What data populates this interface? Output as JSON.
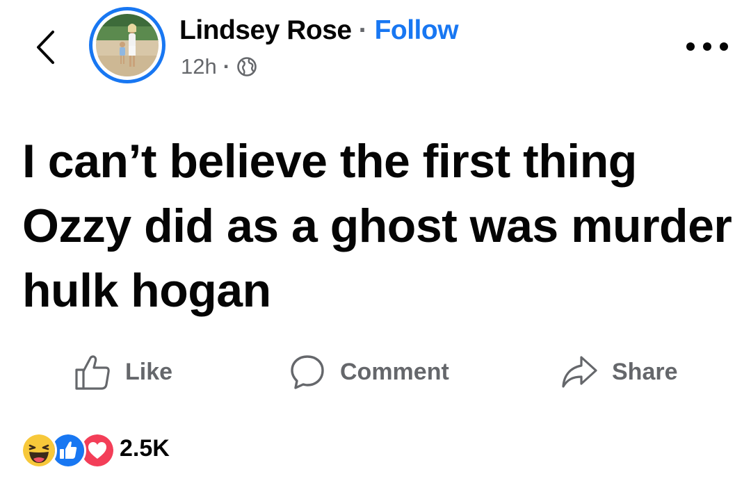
{
  "post": {
    "author": "Lindsey Rose",
    "separator": "·",
    "follow_label": "Follow",
    "timestamp": "12h",
    "meta_separator": "·",
    "audience_icon": "globe-icon",
    "text": "I can’t believe the first thing Ozzy did as a ghost was murder hulk hogan"
  },
  "actions": {
    "like_label": "Like",
    "comment_label": "Comment",
    "share_label": "Share"
  },
  "reactions": {
    "types": [
      "haha-reaction-icon",
      "like-reaction-icon",
      "love-reaction-icon"
    ],
    "count": "2.5K"
  },
  "colors": {
    "accent": "#1877f2",
    "secondary_text": "#65676b",
    "primary_text": "#050505",
    "love": "#f33e58"
  }
}
